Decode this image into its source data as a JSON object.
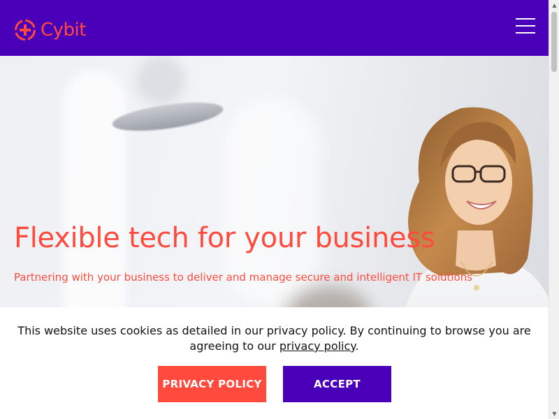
{
  "header": {
    "logo_text": "Cybit",
    "logo_icon": "cybit-logo-icon",
    "menu_icon": "hamburger-menu-icon"
  },
  "hero": {
    "title": "Flexible tech for your business",
    "subtitle": "Partnering with your business to deliver and manage secure and intelligent IT solutions"
  },
  "cookie_banner": {
    "text_before": "This website uses cookies as detailed in our privacy policy. By continuing to browse you are agreeing to our ",
    "link_text": "privacy policy",
    "text_after": ".",
    "privacy_button": "PRIVACY POLICY",
    "accept_button": "ACCEPT"
  },
  "colors": {
    "brand_purple": "#4a00b8",
    "brand_red": "#ff4a3d",
    "white": "#ffffff"
  }
}
